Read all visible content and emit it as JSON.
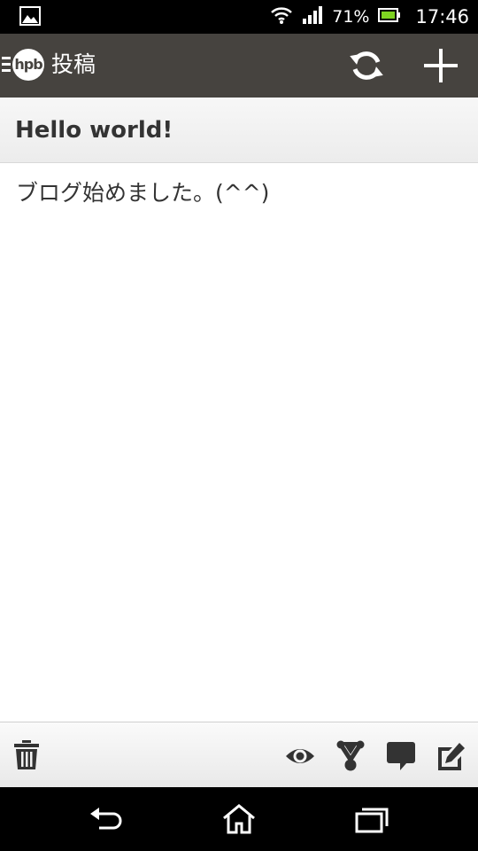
{
  "status_bar": {
    "battery_percent": "71%",
    "time": "17:46"
  },
  "action_bar": {
    "logo_text": "hpb",
    "title": "投稿"
  },
  "post": {
    "title": "Hello world!",
    "body": "ブログ始めました。(^^)"
  },
  "colors": {
    "action_bar_bg": "#46433f",
    "battery_green": "#7ed321",
    "icon_dark": "#333333"
  }
}
